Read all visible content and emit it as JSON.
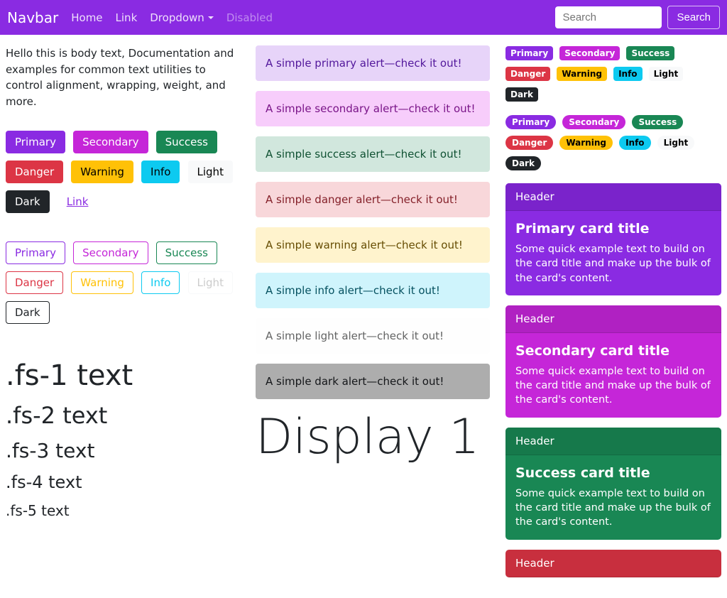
{
  "navbar": {
    "brand": "Navbar",
    "items": [
      "Home",
      "Link",
      "Dropdown",
      "Disabled"
    ],
    "search_placeholder": "Search",
    "search_btn": "Search"
  },
  "intro": "Hello this is body text, Documentation and examples for common text utilities to control alignment, wrapping, weight, and more.",
  "buttons": {
    "primary": "Primary",
    "secondary": "Secondary",
    "success": "Success",
    "danger": "Danger",
    "warning": "Warning",
    "info": "Info",
    "light": "Light",
    "dark": "Dark",
    "link": "Link"
  },
  "fs": {
    "t1": ".fs-1 text",
    "t2": ".fs-2 text",
    "t3": ".fs-3 text",
    "t4": ".fs-4 text",
    "t5": ".fs-5 text"
  },
  "alerts": {
    "primary": "A simple primary alert—check it out!",
    "secondary": "A simple secondary alert—check it out!",
    "success": "A simple success alert—check it out!",
    "danger": "A simple danger alert—check it out!",
    "warning": "A simple warning alert—check it out!",
    "info": "A simple info alert—check it out!",
    "light": "A simple light alert—check it out!",
    "dark": "A simple dark alert—check it out!"
  },
  "display1": "Display 1",
  "badges": {
    "primary": "Primary",
    "secondary": "Secondary",
    "success": "Success",
    "danger": "Danger",
    "warning": "Warning",
    "info": "Info",
    "light": "Light",
    "dark": "Dark"
  },
  "cards": {
    "header": "Header",
    "primary_title": "Primary card title",
    "secondary_title": "Secondary card title",
    "success_title": "Success card title",
    "text": "Some quick example text to build on the card title and make up the bulk of the card's content."
  }
}
